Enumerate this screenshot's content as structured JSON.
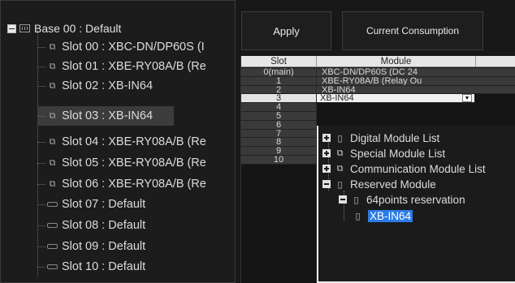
{
  "tree": {
    "root_label": "Base 00 : Default",
    "slots": [
      {
        "label": "Slot 00 : XBC-DN/DP60S (I",
        "type": "module"
      },
      {
        "label": "Slot 01 : XBE-RY08A/B (Re",
        "type": "module"
      },
      {
        "label": "Slot 02 : XB-IN64",
        "type": "module"
      },
      {
        "label": "Slot 03 : XB-IN64",
        "type": "module",
        "selected": true
      },
      {
        "label": "Slot 04 : XBE-RY08A/B (Re",
        "type": "module"
      },
      {
        "label": "Slot 05 : XBE-RY08A/B (Re",
        "type": "module"
      },
      {
        "label": "Slot 06 : XBE-RY08A/B (Re",
        "type": "module"
      },
      {
        "label": "Slot 07 : Default",
        "type": "empty"
      },
      {
        "label": "Slot 08 : Default",
        "type": "empty"
      },
      {
        "label": "Slot 09 : Default",
        "type": "empty"
      },
      {
        "label": "Slot 10 : Default",
        "type": "empty"
      }
    ]
  },
  "toolbar": {
    "apply_label": "Apply",
    "consumption_label": "Current Consumption"
  },
  "grid": {
    "columns": [
      "Slot",
      "Module"
    ],
    "rows": [
      {
        "slot": "0(main)",
        "module": "XBC-DN/DP60S (DC 24"
      },
      {
        "slot": "1",
        "module": "XBE-RY08A/B (Relay Ou"
      },
      {
        "slot": "2",
        "module": "XB-IN64"
      },
      {
        "slot": "3",
        "module": "XB-IN64",
        "selected": true
      },
      {
        "slot": "4",
        "module": ""
      },
      {
        "slot": "5",
        "module": ""
      },
      {
        "slot": "6",
        "module": ""
      },
      {
        "slot": "7",
        "module": ""
      },
      {
        "slot": "8",
        "module": ""
      },
      {
        "slot": "9",
        "module": ""
      },
      {
        "slot": "10",
        "module": ""
      }
    ]
  },
  "module_list": {
    "categories": [
      {
        "label": "Digital Module List",
        "expanded": false
      },
      {
        "label": "Special Module List",
        "expanded": false
      },
      {
        "label": "Communication Module List",
        "expanded": false
      },
      {
        "label": "Reserved Module",
        "expanded": true
      }
    ],
    "reservation_label": "64points reservation",
    "selected_module": "XB-IN64"
  },
  "colors": {
    "background": "#181818",
    "selection": "#2a7be6",
    "text": "#dcdcdc"
  }
}
